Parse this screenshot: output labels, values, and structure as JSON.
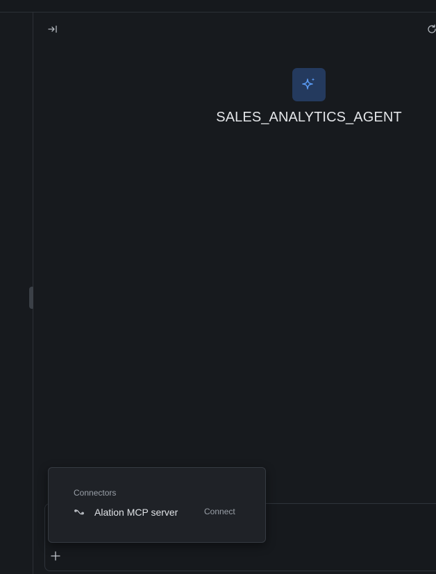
{
  "agent": {
    "name": "SALES_ANALYTICS_AGENT",
    "avatar_icon": "sparkle-icon",
    "accent_color": "#5b9cf5"
  },
  "toolbar": {
    "collapse_icon": "collapse-panel-icon",
    "refresh_icon": "refresh-icon"
  },
  "composer": {
    "add_icon": "plus-icon"
  },
  "connectors_popup": {
    "heading": "Connectors",
    "items": [
      {
        "label": "Alation MCP server",
        "icon": "connector-link-icon",
        "action_label": "Connect"
      }
    ]
  }
}
